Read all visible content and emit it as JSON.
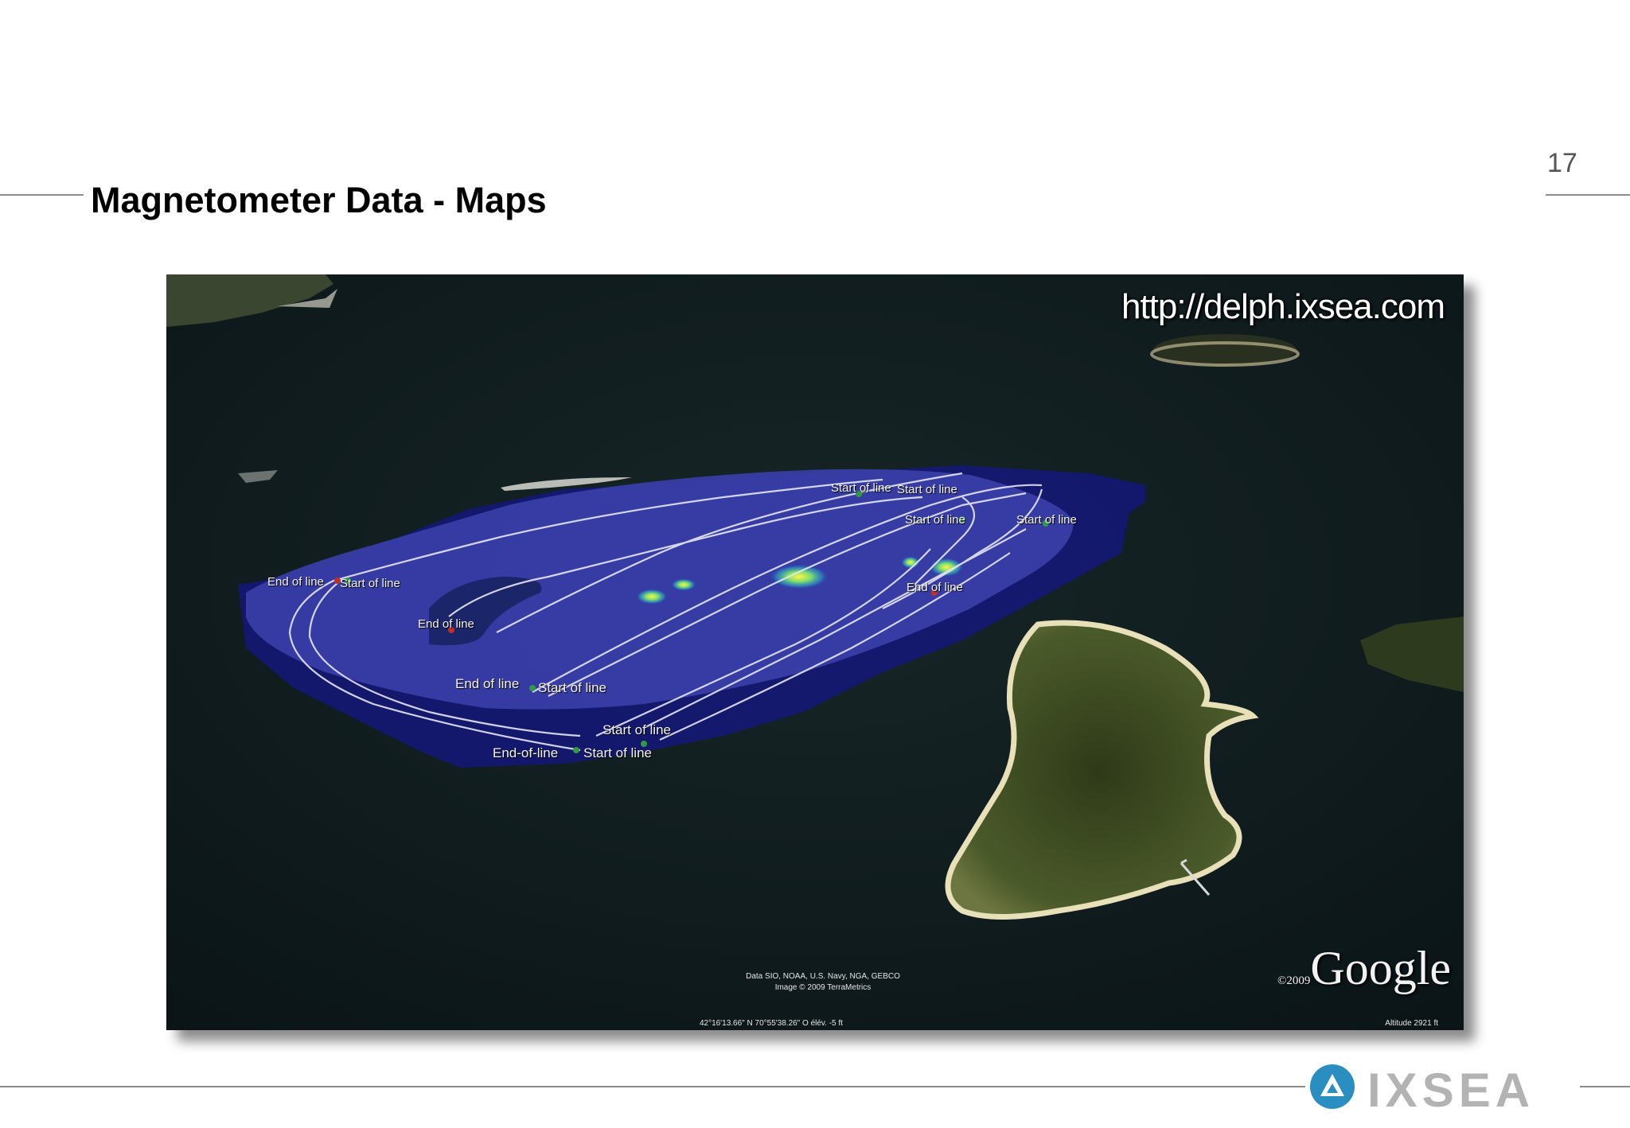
{
  "slide": {
    "page_number": "17",
    "title": "Magnetometer Data - Maps"
  },
  "map": {
    "url_overlay": "http://delph.ixsea.com",
    "line_labels": {
      "start_top_a": "Start of line",
      "start_top_b": "Start of line",
      "start_mid_a": "Start of line",
      "start_mid_b": "Start of line",
      "end_left_a": "End of line",
      "start_left_a": "Start of line",
      "end_inner": "End of line",
      "end_right": "End of line",
      "end_bottom_a": "End of line",
      "start_bottom_a": "Start of line",
      "start_bottom_b": "Start of line",
      "end_bottom_c": "End-of-line",
      "start_bottom_c": "Start of line"
    },
    "credits_line1": "Data SIO, NOAA, U.S. Navy, NGA, GEBCO",
    "credits_line2": "Image © 2009 TerraMetrics",
    "coordinates": "42°16'13.66\" N    70°55'38.26\" O    élév.  -5 ft",
    "altitude": "Altitude    2921 ft",
    "google_year": "©2009",
    "google_word": "Google",
    "colors": {
      "water": "#0f1c1e",
      "survey_overlay": "#2a2f9a",
      "survey_dark": "#14187a",
      "track_lines": "#e6e6f2",
      "anomaly_hotspot": "#ffe23a",
      "island_vegetation": "#3d4a22",
      "beach": "#e8e0b8"
    }
  },
  "branding": {
    "logo_text": "IXSEA",
    "logo_icon": "ixsea-triangle-icon",
    "logo_color": "#2a8fc0"
  }
}
